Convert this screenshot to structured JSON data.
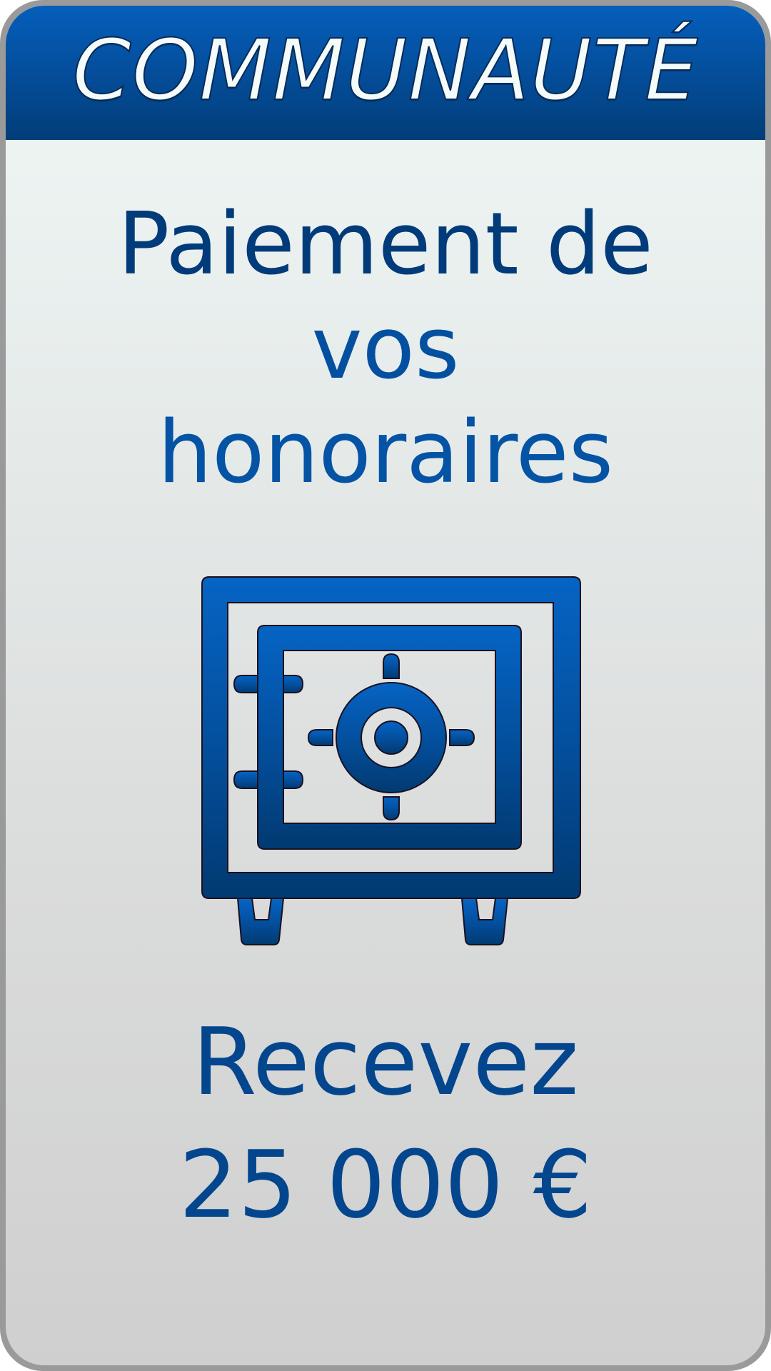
{
  "header": {
    "title": "COMMUNAUTÉ"
  },
  "card": {
    "title_lines": [
      "Paiement de",
      "vos",
      "honoraires"
    ],
    "icon": "safe-icon",
    "reward_line1": "Recevez",
    "reward_amount": "25 000 €"
  },
  "colors": {
    "header_top": "#0560be",
    "header_bottom": "#023d78",
    "text_dark_blue": "#023b7a",
    "text_blue": "#0450a0",
    "border_gray": "#9a9a9a"
  }
}
